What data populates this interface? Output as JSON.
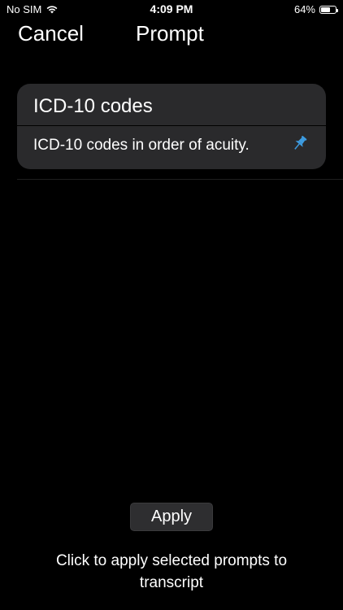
{
  "status_bar": {
    "carrier": "No SIM",
    "time": "4:09 PM",
    "battery_percent": "64%",
    "battery_level": 0.64
  },
  "nav": {
    "cancel_label": "Cancel",
    "title": "Prompt"
  },
  "prompts": [
    {
      "name": "ICD-10 codes",
      "text": "ICD-10 codes in order of acuity.",
      "pinned": true,
      "pin_icon": "pushpin-icon",
      "pin_color": "#3d9be0"
    }
  ],
  "apply_label": "Apply",
  "hint": "Click to apply selected prompts to transcript",
  "colors": {
    "background": "#000000",
    "card": "#2a2a2c",
    "accent": "#3d9be0"
  }
}
